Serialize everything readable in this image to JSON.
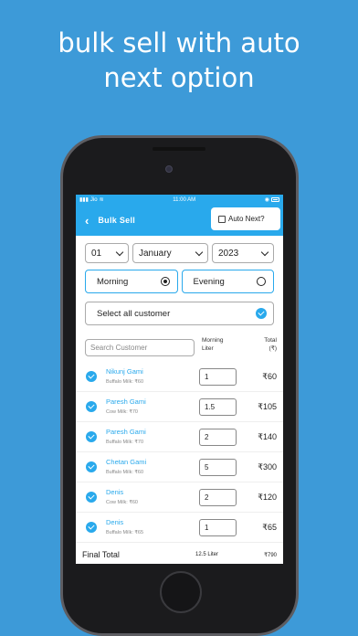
{
  "headline": {
    "line1": "bulk sell with auto",
    "line2": "next option"
  },
  "status_bar": {
    "carrier": "Jio",
    "time": "11:00 AM"
  },
  "app_bar": {
    "back_symbol": "‹",
    "title": "Bulk Sell",
    "auto_next_label": "Auto Next?",
    "auto_next_checked": false
  },
  "date": {
    "day": "01",
    "month": "January",
    "year": "2023"
  },
  "shifts": [
    {
      "label": "Morning",
      "selected": true
    },
    {
      "label": "Evening",
      "selected": false
    }
  ],
  "select_all_label": "Select all customer",
  "search_placeholder": "Search Customer",
  "columns": {
    "qty_header_1": "Morning",
    "qty_header_2": "Liter",
    "total_header_1": "Total",
    "total_header_2": "(₹)"
  },
  "customers": [
    {
      "name": "Nikunj Gami",
      "milk": "Buffalo Milk: ₹60",
      "qty": "1",
      "total": "₹60"
    },
    {
      "name": "Paresh Gami",
      "milk": "Cow Milk: ₹70",
      "qty": "1.5",
      "total": "₹105"
    },
    {
      "name": "Paresh Gami",
      "milk": "Buffalo Milk: ₹70",
      "qty": "2",
      "total": "₹140"
    },
    {
      "name": "Chetan Gami",
      "milk": "Buffalo Milk: ₹60",
      "qty": "5",
      "total": "₹300"
    },
    {
      "name": "Denis",
      "milk": "Cow Milk: ₹60",
      "qty": "2",
      "total": "₹120"
    },
    {
      "name": "Denis",
      "milk": "Buffalo Milk: ₹65",
      "qty": "1",
      "total": "₹65"
    }
  ],
  "final": {
    "label": "Final Total",
    "liters": "12.5 Liter",
    "total": "₹790"
  },
  "colors": {
    "background": "#3d9ad8",
    "accent": "#29a9ec",
    "phone_frame": "#1b1b1d"
  }
}
